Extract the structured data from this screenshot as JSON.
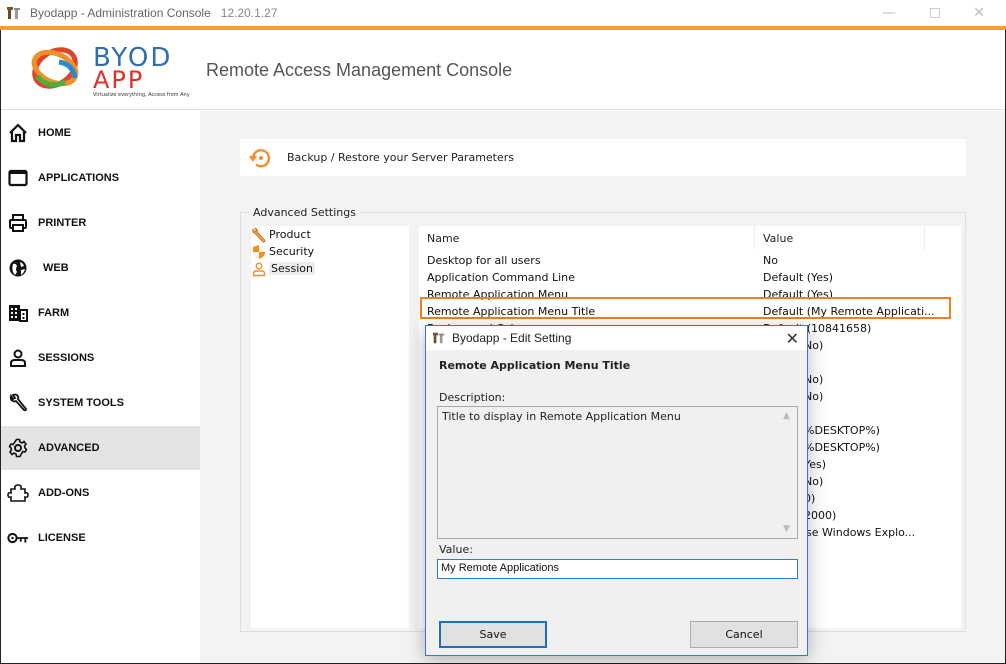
{
  "window": {
    "title": "Byodapp - Administration Console",
    "version": "12.20.1.27",
    "controls": [
      "minimize",
      "maximize",
      "close"
    ],
    "accent_color": "#f0a030"
  },
  "header": {
    "logo_text_top": "BYOD",
    "logo_text_bottom": "APP",
    "logo_tagline": "Virtualize everything, Access from Anywhere",
    "console_title": "Remote Access Management Console"
  },
  "sidebar": {
    "items": [
      {
        "label": "HOME",
        "icon": "home-icon"
      },
      {
        "label": "APPLICATIONS",
        "icon": "window-icon"
      },
      {
        "label": "PRINTER",
        "icon": "printer-icon"
      },
      {
        "label": "WEB",
        "icon": "globe-icon"
      },
      {
        "label": "FARM",
        "icon": "building-icon"
      },
      {
        "label": "SESSIONS",
        "icon": "user-icon"
      },
      {
        "label": "SYSTEM TOOLS",
        "icon": "wrench-icon"
      },
      {
        "label": "ADVANCED",
        "icon": "gear-icon",
        "active": true
      },
      {
        "label": "ADD-ONS",
        "icon": "puzzle-icon"
      },
      {
        "label": "LICENSE",
        "icon": "key-icon"
      }
    ]
  },
  "main": {
    "backup_label": "Backup / Restore your Server Parameters",
    "group_title": "Advanced Settings",
    "tree": [
      {
        "label": "Product",
        "icon": "wrench-icon"
      },
      {
        "label": "Security",
        "icon": "shield-icon"
      },
      {
        "label": "Session",
        "icon": "user-icon",
        "selected": true
      }
    ],
    "grid": {
      "columns": [
        "Name",
        "Value"
      ],
      "rows": [
        {
          "name": "Desktop for all users",
          "value": "No"
        },
        {
          "name": "Application Command Line",
          "value": "Default (Yes)"
        },
        {
          "name": "Remote Application Menu",
          "value": "Default (Yes)"
        },
        {
          "name": "Remote Application Menu Title",
          "value": "Default (My Remote Applicati...",
          "highlighted": true
        },
        {
          "name": "Background Color",
          "value": "Default (10841658)"
        },
        {
          "name": "",
          "value": "No)"
        },
        {
          "name": "",
          "value": ""
        },
        {
          "name": "",
          "value": "No)"
        },
        {
          "name": "",
          "value": "No)"
        },
        {
          "name": "",
          "value": ""
        },
        {
          "name": "",
          "value": "%DESKTOP%)"
        },
        {
          "name": "",
          "value": "%DESKTOP%)"
        },
        {
          "name": "",
          "value": "Yes)"
        },
        {
          "name": "",
          "value": "No)"
        },
        {
          "name": "",
          "value": "0)"
        },
        {
          "name": "",
          "value": "2000)"
        },
        {
          "name": "",
          "value": "Use Windows Explo..."
        }
      ]
    }
  },
  "dialog": {
    "title": "Byodapp -  Edit Setting",
    "heading": "Remote Application Menu Title",
    "description_label": "Description:",
    "description": "Title to display in Remote Application Menu",
    "value_label": "Value:",
    "value": "My Remote Applications",
    "save_label": "Save",
    "cancel_label": "Cancel",
    "border_color": "#2b7bd0"
  }
}
